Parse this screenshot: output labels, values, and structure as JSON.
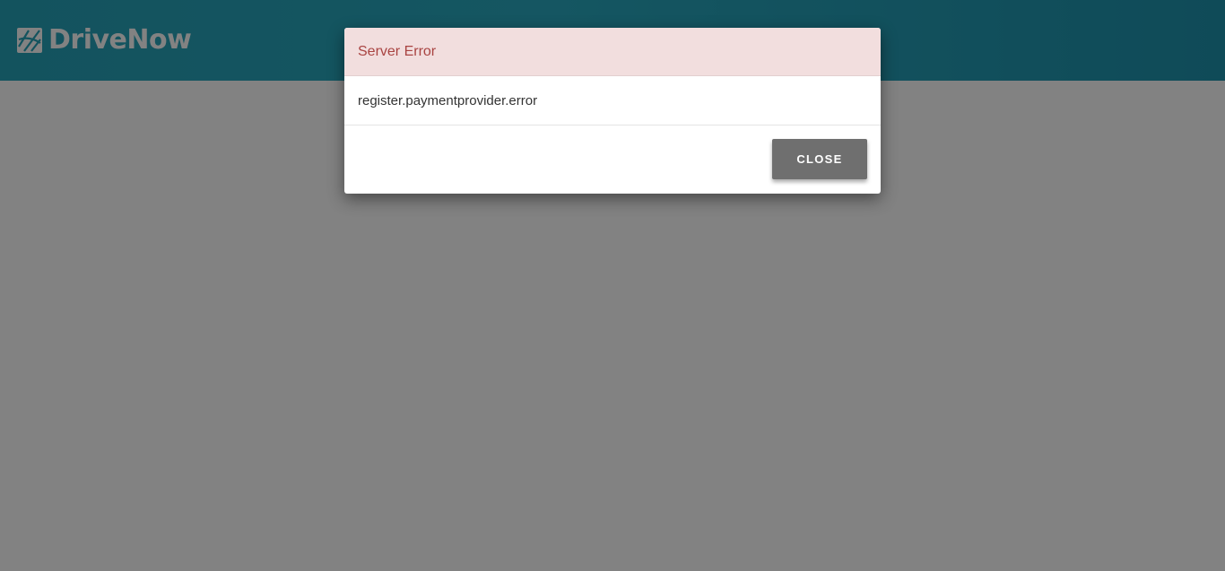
{
  "app": {
    "brand": "DriveNow",
    "logo_icon": "drivenow-logo-icon",
    "header_color": "#27a3b9"
  },
  "dialog": {
    "title": "Server Error",
    "message": "register.paymentprovider.error",
    "close_label": "CLOSE",
    "title_color": "#a94442",
    "header_bg": "#f2dede",
    "button_bg": "#6f6f6f"
  }
}
